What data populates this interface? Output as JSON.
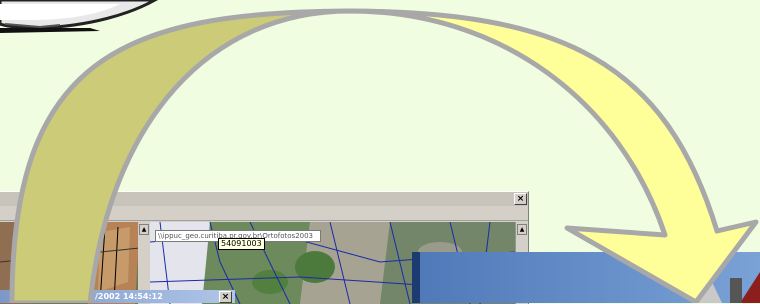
{
  "window": {
    "close_glyph": "×",
    "path_text": "\\\\ippuc_geo.curitiba.pr.gov.br\\Ortofotos2003",
    "lot_id": "54091003",
    "status_timestamp": "/2002 14:54:12",
    "status_close_glyph": "×"
  },
  "scroll": {
    "up_glyph": "▲"
  },
  "colors": {
    "background": "#f1fde1",
    "arrow_left": "#cccc78",
    "arrow_right": "#ffff99",
    "arrow_outline": "#a8a8a8",
    "status_bar": "#7b98c8",
    "photo_sky": "#5f86c4"
  },
  "icons": [
    "close-icon",
    "scroll-up-icon"
  ]
}
